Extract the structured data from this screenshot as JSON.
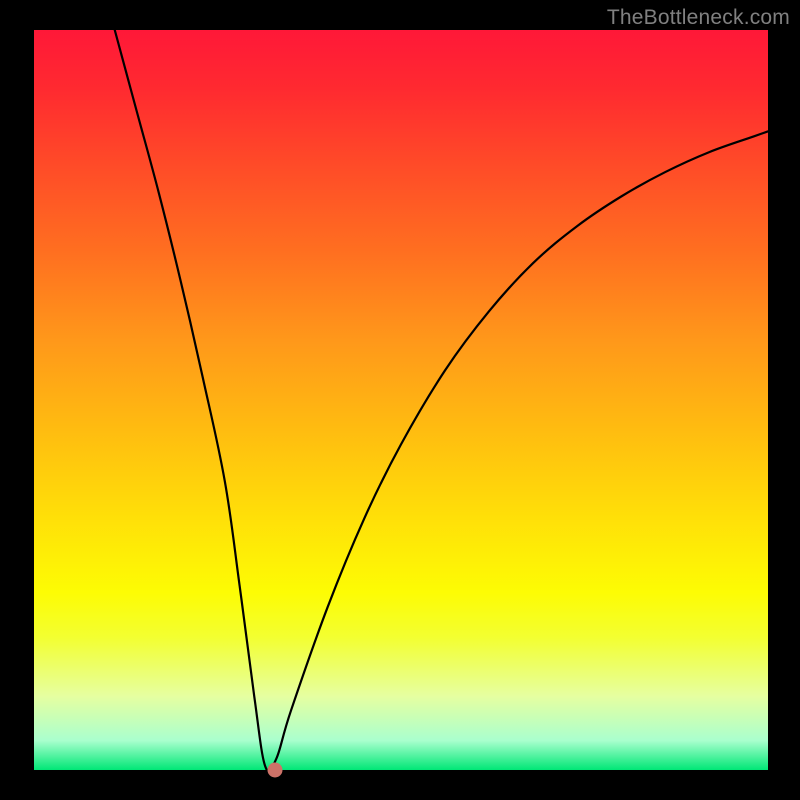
{
  "watermark": "TheBottleneck.com",
  "chart_data": {
    "type": "line",
    "title": "",
    "xlabel": "",
    "ylabel": "",
    "xlim": [
      0,
      100
    ],
    "ylim": [
      0,
      100
    ],
    "grid": false,
    "legend": false,
    "series": [
      {
        "name": "curve",
        "x": [
          11,
          14,
          17,
          20,
          23,
          26,
          28,
          30,
          31.5,
          33,
          35,
          40,
          45,
          50,
          56,
          62,
          68,
          74,
          80,
          86,
          92,
          98,
          100
        ],
        "y": [
          100,
          89,
          78,
          66,
          53,
          39,
          25,
          10,
          0.5,
          1.5,
          8,
          22,
          34,
          44,
          54,
          62,
          68.5,
          73.5,
          77.5,
          80.8,
          83.5,
          85.6,
          86.3
        ]
      }
    ],
    "marker": {
      "x": 32.8,
      "y": 0.0
    }
  },
  "colors": {
    "curve": "#000000",
    "marker": "#cd7268",
    "frame": "#000000"
  }
}
